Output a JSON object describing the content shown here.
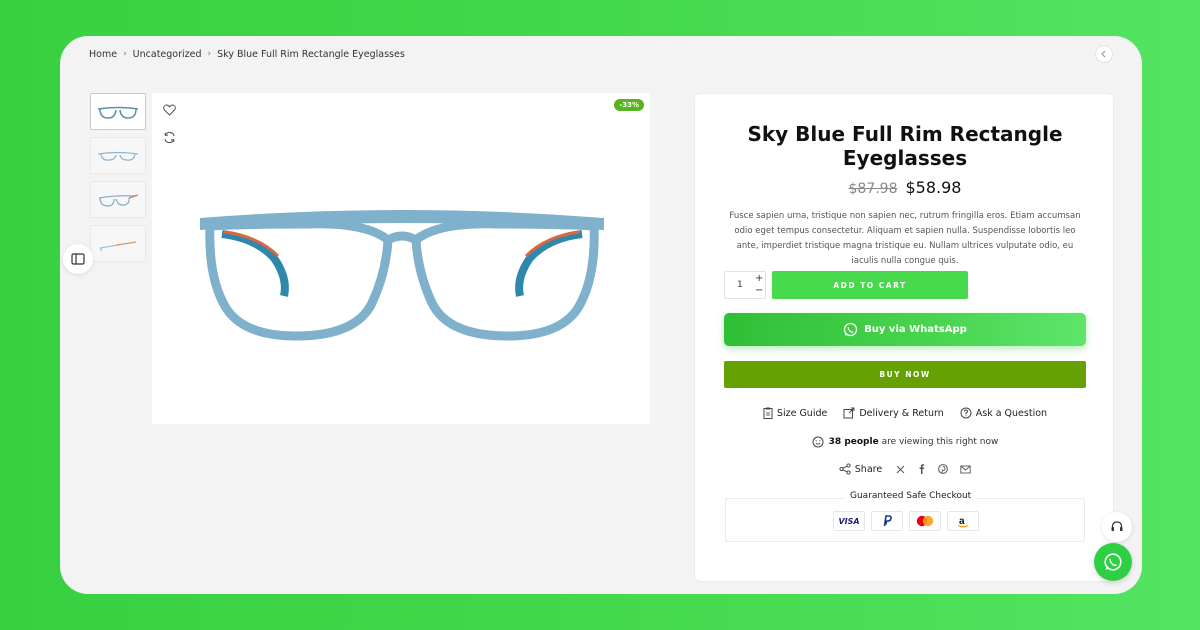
{
  "breadcrumb": {
    "items": [
      "Home",
      "Uncategorized",
      "Sky Blue Full Rim Rectangle Eyeglasses"
    ],
    "separator": "›"
  },
  "gallery": {
    "discount_badge": "-33%",
    "icons": [
      "heart-icon",
      "compare-icon",
      "sidebar-toggle-icon"
    ]
  },
  "product": {
    "title": "Sky Blue Full Rim Rectangle Eyeglasses",
    "old_price": "$87.98",
    "new_price": "$58.98",
    "description": "Fusce sapien urna, tristique non sapien nec, rutrum fringilla eros. Etiam accumsan odio eget tempus consectetur. Aliquam et sapien nulla. Suspendisse lobortis leo ante, imperdiet tristique magna tristique eu. Nullam ultrices vulputate odio, eu iaculis nulla congue quis."
  },
  "cart": {
    "quantity": "1",
    "plus": "+",
    "minus": "−",
    "add_to_cart": "ADD TO CART",
    "whatsapp": "Buy via WhatsApp",
    "buy_now": "BUY NOW"
  },
  "links": {
    "size_guide": "Size Guide",
    "delivery": "Delivery & Return",
    "ask": "Ask a Question"
  },
  "viewers": {
    "count": "38 people",
    "suffix": "are viewing this right now"
  },
  "share": {
    "label": "Share",
    "icons": [
      "x-icon",
      "facebook-icon",
      "pinterest-icon",
      "email-icon"
    ]
  },
  "checkout": {
    "title": "Guaranteed Safe Checkout",
    "methods": [
      "VISA",
      "PayPal",
      "Mastercard",
      "Amazon"
    ]
  },
  "colors": {
    "background": "#44d84c",
    "add_to_cart": "#45d94b",
    "buy_now": "#66a104",
    "badge": "#59b21f",
    "frame": "#7fb0cc"
  }
}
